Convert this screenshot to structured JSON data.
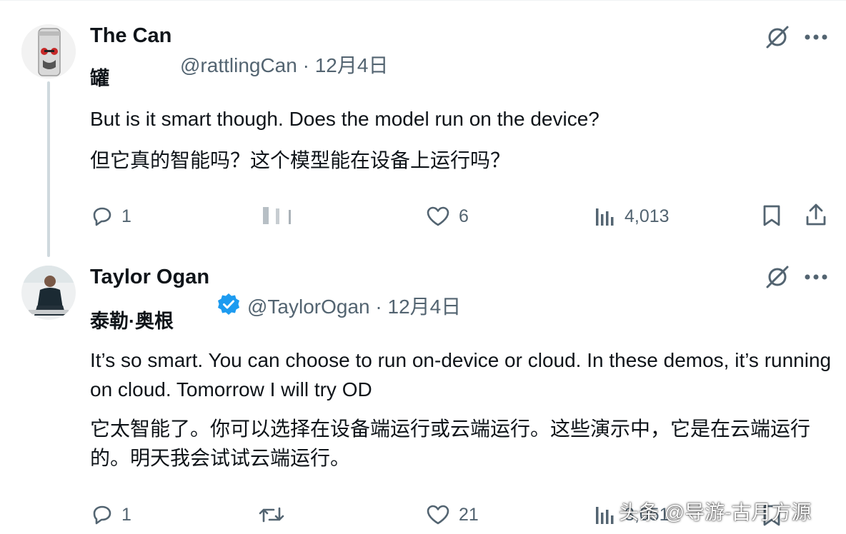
{
  "colors": {
    "text": "#0f1419",
    "secondary": "#536471",
    "verified": "#1d9bf0",
    "thread_line": "#cfd9de"
  },
  "posts": [
    {
      "display_name": "The Can",
      "chinese_name": "罐",
      "handle": "@rattlingCan",
      "date": "12月4日",
      "separator": "·",
      "verified": false,
      "text_en": "But is it smart though. Does the model run on the device?",
      "text_zh": "但它真的智能吗？这个模型能在设备上运行吗？",
      "replies": "1",
      "likes": "6",
      "views": "4,013",
      "icons": [
        "grok-icon",
        "more-icon",
        "reply-icon",
        "repost-icon",
        "like-icon",
        "views-icon",
        "bookmark-icon",
        "share-icon"
      ]
    },
    {
      "display_name": "Taylor Ogan",
      "chinese_name": "泰勒·奥根",
      "handle": "@TaylorOgan",
      "date": "12月4日",
      "separator": "·",
      "verified": true,
      "text_en": "It’s so smart. You can choose to run on-device or cloud. In these demos, it’s running on cloud. Tomorrow I will try OD",
      "text_zh": "它太智能了。你可以选择在设备端运行或云端运行。这些演示中，它是在云端运行的。明天我会试试云端运行。",
      "replies": "1",
      "likes": "21",
      "views": "3,051",
      "icons": [
        "grok-icon",
        "more-icon",
        "reply-icon",
        "repost-icon",
        "like-icon",
        "views-icon",
        "bookmark-icon"
      ]
    }
  ],
  "watermark": "头条 @导游-古月方源"
}
